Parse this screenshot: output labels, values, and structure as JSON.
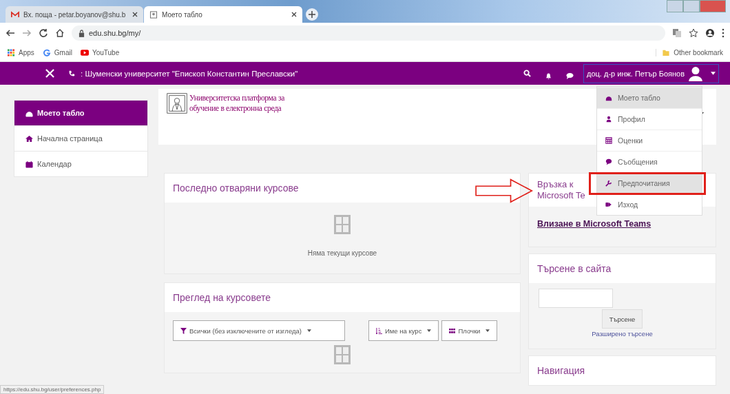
{
  "browser": {
    "tabs": [
      {
        "kind": "mail",
        "title": "Вх. поща - petar.boyanov@shu.b",
        "selected": false
      },
      {
        "kind": "page",
        "title": "Моето табло",
        "selected": true
      }
    ],
    "address": "edu.shu.bg/my/",
    "bookmarks": [
      {
        "kind": "apps",
        "label": "Apps"
      },
      {
        "kind": "gmail",
        "label": "Gmail"
      },
      {
        "kind": "youtube",
        "label": "YouTube"
      }
    ],
    "other_bookmarks": "Other bookmark"
  },
  "navbar": {
    "site": ": Шуменски университет \"Епископ Константин Преславски\"",
    "user": "доц. д-р инж. Петър Боянов"
  },
  "sidebar": {
    "items": [
      {
        "kind": "dashboard",
        "label": "Моето табло",
        "selected": true
      },
      {
        "kind": "home",
        "label": "Начална страница",
        "selected": false
      },
      {
        "kind": "calendar",
        "label": "Календар",
        "selected": false
      }
    ]
  },
  "logo": {
    "line_1": "Университетска платформа за",
    "line_2": "обучение в електронна среда"
  },
  "recent": {
    "title": "Последно отваряни курсове",
    "empty": "Няма текущи курсове"
  },
  "overview": {
    "title": "Преглед на курсовете",
    "filters": [
      {
        "kind": "filter",
        "label": "Всички (без изключените от изгледа)"
      },
      {
        "kind": "sort",
        "label": "Име на курс"
      },
      {
        "kind": "grid",
        "label": "Плочки"
      }
    ]
  },
  "teams": {
    "title": "Връзка к Microsoft Te",
    "link": "Влизане в Microsoft Teams"
  },
  "search": {
    "title": "Търсене в сайта",
    "button": "Търсене",
    "advanced": "Разширено търсене"
  },
  "navigation": {
    "title": "Навигация"
  },
  "user_menu": {
    "items": [
      {
        "kind": "dashboard",
        "label": "Моето табло",
        "highlighted": true
      },
      {
        "kind": "user",
        "label": "Профил",
        "highlighted": false
      },
      {
        "kind": "table",
        "label": "Оценки",
        "highlighted": false
      },
      {
        "kind": "chat",
        "label": "Съобщения",
        "highlighted": false
      },
      {
        "kind": "wrench",
        "label": "Предпочитания",
        "highlighted": true
      },
      {
        "kind": "exit",
        "label": "Изход",
        "highlighted": false
      }
    ]
  },
  "status_url": "https://edu.shu.bg/user/preferences.php"
}
